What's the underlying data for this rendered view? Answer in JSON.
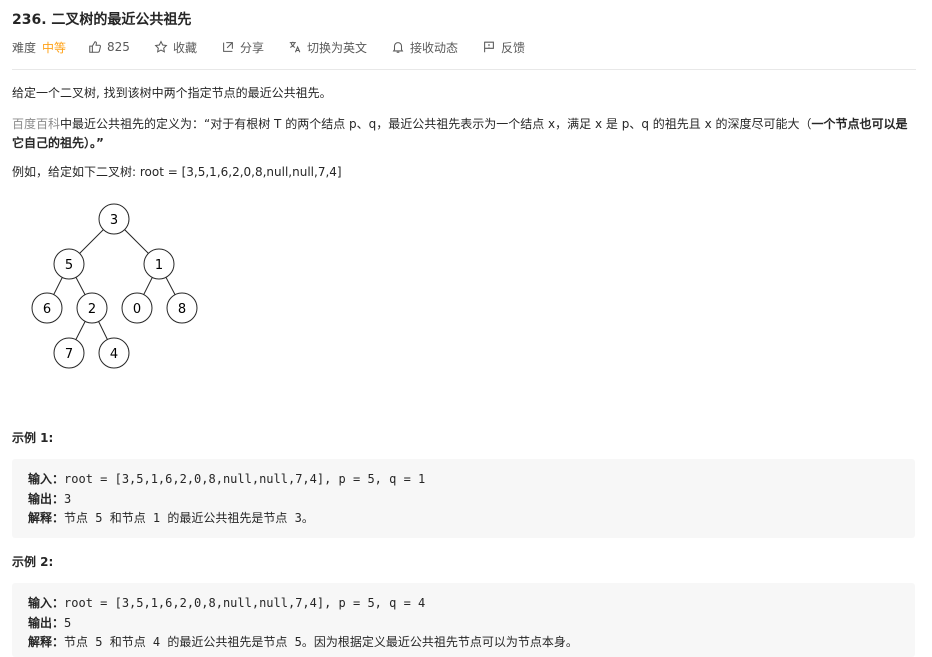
{
  "problem": {
    "title": "236. 二叉树的最近公共祖先",
    "difficulty_label": "难度",
    "difficulty": "中等",
    "likes": "825"
  },
  "actions": {
    "favorite": "收藏",
    "share": "分享",
    "switch_lang": "切换为英文",
    "notify": "接收动态",
    "feedback": "反馈"
  },
  "description": {
    "intro": "给定一个二叉树, 找到该树中两个指定节点的最近公共祖先。",
    "baike_link": "百度百科",
    "definition_text": "中最近公共祖先的定义为：“对于有根树 T 的两个结点 p、q，最近公共祖先表示为一个结点 x，满足 x 是 p、q 的祖先且 x 的深度尽可能大（",
    "definition_bold": "一个节点也可以是它自己的祖先",
    "definition_end": "）。”",
    "example_tree_text": "例如，给定如下二叉树:  root = [3,5,1,6,2,0,8,null,null,7,4]"
  },
  "tree": {
    "nodes": [
      "3",
      "5",
      "1",
      "6",
      "2",
      "0",
      "8",
      "7",
      "4"
    ]
  },
  "examples": [
    {
      "title": "示例 1:",
      "input_label": "输入：",
      "input": "root = [3,5,1,6,2,0,8,null,null,7,4], p = 5, q = 1",
      "output_label": "输出：",
      "output": "3",
      "explain_label": "解释：",
      "explain": "节点 5 和节点 1 的最近公共祖先是节点 3。"
    },
    {
      "title": "示例 2:",
      "input_label": "输入：",
      "input": "root = [3,5,1,6,2,0,8,null,null,7,4], p = 5, q = 4",
      "output_label": "输出：",
      "output": "5",
      "explain_label": "解释：",
      "explain": "节点 5 和节点 4 的最近公共祖先是节点 5。因为根据定义最近公共祖先节点可以为节点本身。"
    }
  ]
}
